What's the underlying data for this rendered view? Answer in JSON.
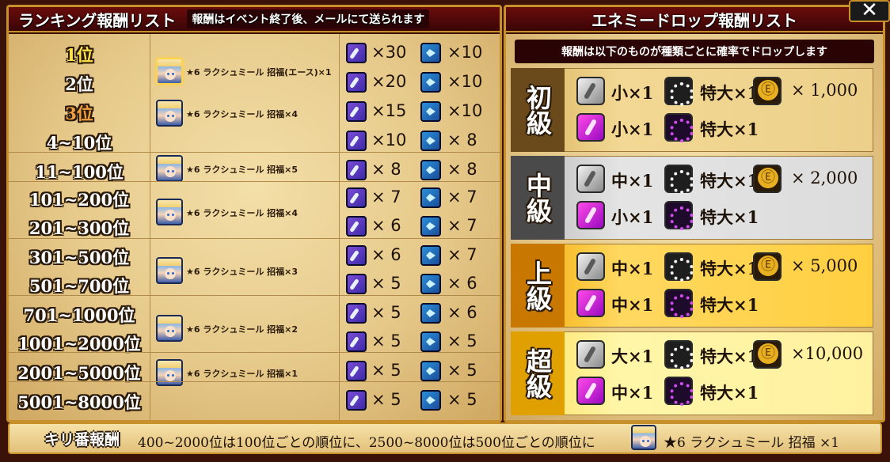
{
  "ranking_panel": {
    "title": "ランキング報酬リスト",
    "note": "報酬はイベント終了後、メールにて送られます",
    "ranks": [
      "1位",
      "2位",
      "3位",
      "4~10位",
      "11~100位",
      "101~200位",
      "201~300位",
      "301~500位",
      "501~700位",
      "701~1000位",
      "1001~2000位",
      "2001~5000位",
      "5001~8000位"
    ],
    "scouts": [
      {
        "label": "★6 ラクシュミール 招福(エース)×1"
      },
      {
        "label": "★6 ラクシュミール 招福×4"
      },
      {
        "label": "★6 ラクシュミール 招福×5"
      },
      {
        "label": "★6 ラクシュミール 招福×4"
      },
      {
        "label": "★6 ラクシュミール 招福×3"
      },
      {
        "label": "★6 ラクシュミール 招福×2"
      },
      {
        "label": "★6 ラクシュミール 招福×1"
      }
    ],
    "items": [
      {
        "a": "×30",
        "b": "×10"
      },
      {
        "a": "×20",
        "b": "×10"
      },
      {
        "a": "×15",
        "b": "×10"
      },
      {
        "a": "×10",
        "b": "× 8"
      },
      {
        "a": "× 8",
        "b": "× 8"
      },
      {
        "a": "× 7",
        "b": "× 7"
      },
      {
        "a": "× 6",
        "b": "× 7"
      },
      {
        "a": "× 6",
        "b": "× 7"
      },
      {
        "a": "× 5",
        "b": "× 6"
      },
      {
        "a": "× 5",
        "b": "× 6"
      },
      {
        "a": "× 5",
        "b": "× 5"
      },
      {
        "a": "× 5",
        "b": "× 5"
      },
      {
        "a": "× 5",
        "b": "× 5"
      }
    ]
  },
  "drop_panel": {
    "title": "エネミードロップ報酬リスト",
    "note": "報酬は以下のものが種類ごとに確率でドロップします",
    "difficulties": [
      {
        "label": "初級",
        "r1a": "小×1",
        "r1b": "特大×1",
        "coins": "× 1,000",
        "r2a": "小×1",
        "r2b": "特大×1"
      },
      {
        "label": "中級",
        "r1a": "中×1",
        "r1b": "特大×1",
        "coins": "× 2,000",
        "r2a": "小×1",
        "r2b": "特大×1"
      },
      {
        "label": "上級",
        "r1a": "中×1",
        "r1b": "特大×1",
        "coins": "× 5,000",
        "r2a": "中×1",
        "r2b": "特大×1"
      },
      {
        "label": "超級",
        "r1a": "大×1",
        "r1b": "特大×1",
        "coins": "×10,000",
        "r2a": "中×1",
        "r2b": "特大×1"
      }
    ]
  },
  "footer": {
    "label": "キリ番報酬",
    "text": "400~2000位は100位ごとの順位に、2500~8000位は500位ごとの順位に",
    "reward": "★6 ラクシュミール 招福 ×1"
  },
  "close_icon": "close-icon"
}
